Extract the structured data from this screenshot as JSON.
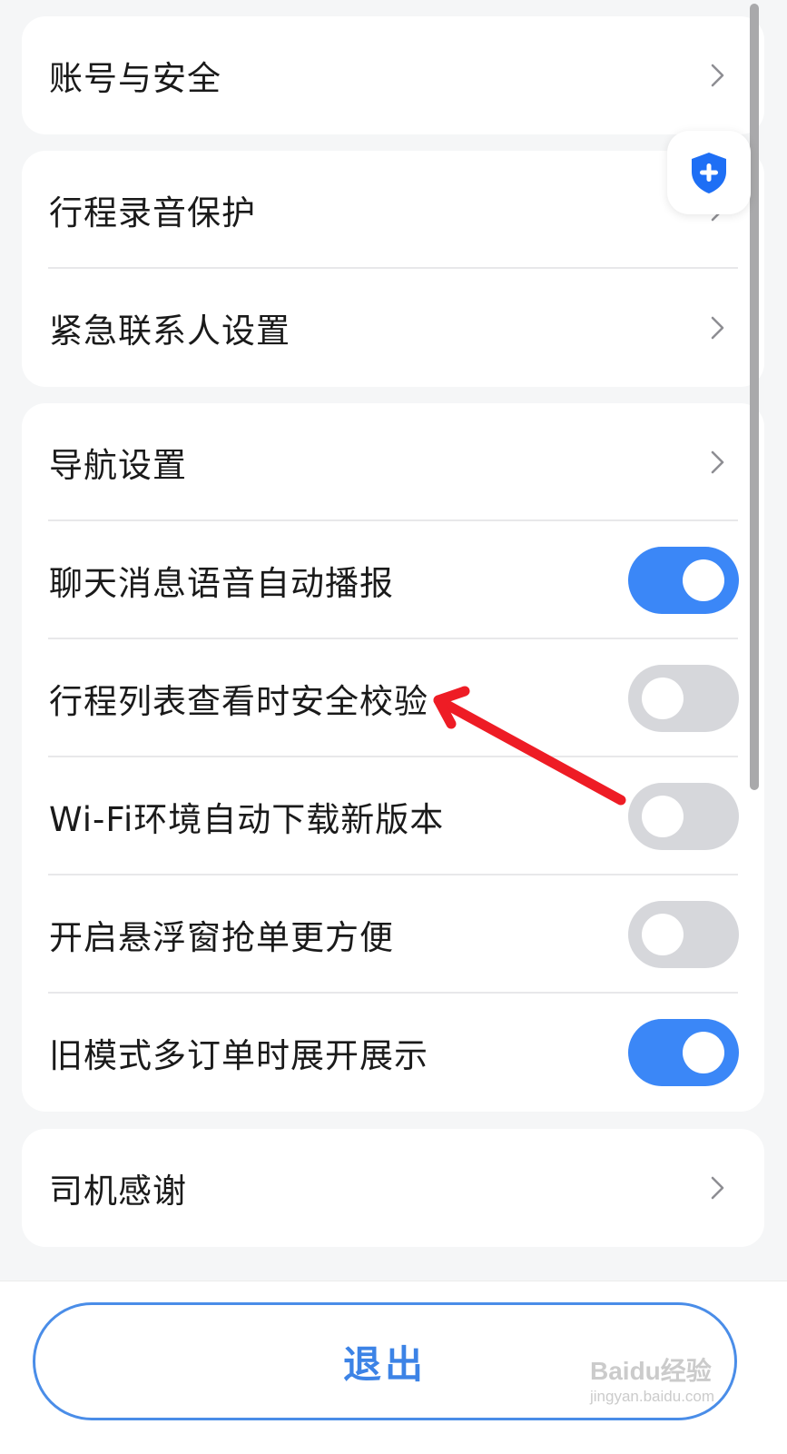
{
  "settings": {
    "account_security": "账号与安全",
    "trip_recording": "行程录音保护",
    "emergency_contacts": "紧急联系人设置",
    "navigation": "导航设置",
    "chat_voice_broadcast": {
      "label": "聊天消息语音自动播报",
      "enabled": true
    },
    "trip_list_verification": {
      "label": "行程列表查看时安全校验",
      "enabled": false
    },
    "wifi_auto_download": {
      "label": "Wi-Fi环境自动下载新版本",
      "enabled": false
    },
    "floating_window": {
      "label": "开启悬浮窗抢单更方便",
      "enabled": false
    },
    "old_mode_expand": {
      "label": "旧模式多订单时展开展示",
      "enabled": true
    },
    "driver_thanks": "司机感谢"
  },
  "footer": {
    "logout_label": "退出"
  },
  "watermark": {
    "brand": "Baidu经验",
    "url": "jingyan.baidu.com"
  },
  "colors": {
    "accent": "#3b87f7",
    "toggle_off": "#d6d7db",
    "annotation_arrow": "#ee1c25",
    "shield": "#1e6ff5"
  },
  "icons": {
    "chevron": "chevron-right-icon",
    "shield": "shield-plus-icon"
  }
}
